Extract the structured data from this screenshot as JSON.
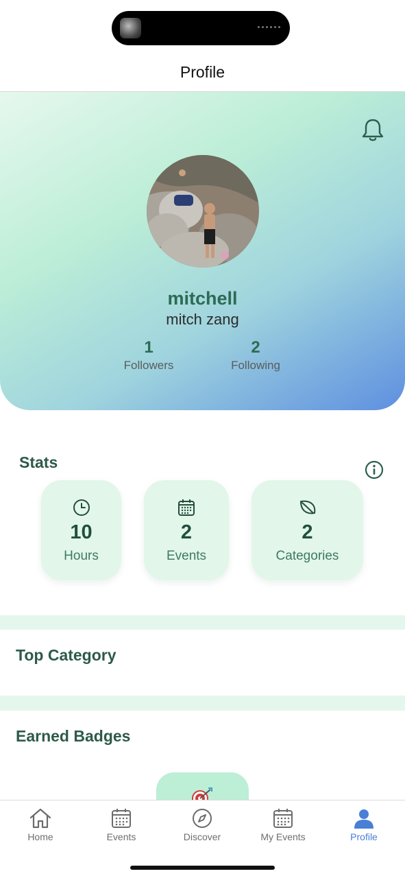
{
  "nav": {
    "title": "Profile"
  },
  "profile": {
    "username": "mitchell",
    "full_name": "mitch zang",
    "followers": {
      "count": "1",
      "label": "Followers"
    },
    "following": {
      "count": "2",
      "label": "Following"
    }
  },
  "stats": {
    "title": "Stats",
    "items": [
      {
        "icon": "clock-icon",
        "value": "10",
        "label": "Hours"
      },
      {
        "icon": "calendar-icon",
        "value": "2",
        "label": "Events"
      },
      {
        "icon": "leaf-icon",
        "value": "2",
        "label": "Categories"
      }
    ]
  },
  "top_category": {
    "title": "Top Category"
  },
  "badges": {
    "title": "Earned Badges",
    "items": [
      {
        "icon": "target-arrow-icon"
      }
    ]
  },
  "tabbar": {
    "items": [
      {
        "label": "Home",
        "icon": "home-icon"
      },
      {
        "label": "Events",
        "icon": "calendar-icon"
      },
      {
        "label": "Discover",
        "icon": "compass-icon"
      },
      {
        "label": "My Events",
        "icon": "calendar-icon"
      },
      {
        "label": "Profile",
        "icon": "person-icon"
      }
    ],
    "active": "Profile"
  },
  "colors": {
    "accent_green": "#2e6a55",
    "accent_blue": "#4a7fd6",
    "card_bg": "#e2f6ea"
  }
}
